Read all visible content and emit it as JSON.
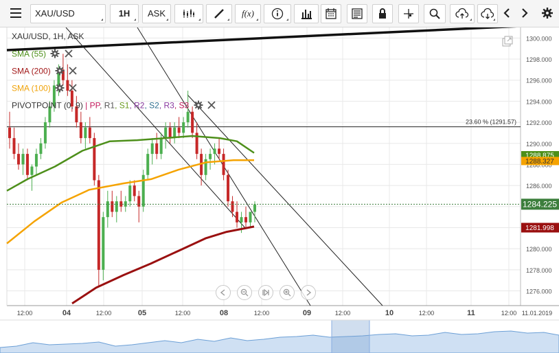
{
  "toolbar": {
    "menu_icon": "hamburger-icon",
    "symbol": "XAU/USD",
    "timeframe": "1H",
    "price_side": "ASK",
    "icons": [
      "candle-type-icon",
      "draw-line-icon",
      "function-icon",
      "info-icon",
      "bar-chart-icon",
      "calendar-icon",
      "news-icon",
      "lock-icon",
      "crosshair-icon",
      "zoom-icon",
      "upload-icon",
      "download-icon",
      "prev-icon",
      "next-icon",
      "settings-icon"
    ],
    "fx_label": "f(x)"
  },
  "chart_title": "XAU/USD, 1H, ASK",
  "indicators": {
    "sma55": {
      "label": "SMA (55)",
      "color": "#4d8f1a"
    },
    "sma200": {
      "label": "SMA (200)",
      "color": "#a31a1a"
    },
    "sma100": {
      "label": "SMA (100)",
      "color": "#f0a30a"
    },
    "pivot": {
      "label": "PIVOTPOINT",
      "params": "(0, 9)",
      "levels": [
        "PP",
        "R1",
        "S1",
        "R2",
        "S2",
        "R3",
        "S3"
      ],
      "level_colors": [
        "#c2185b",
        "#555555",
        "#6a9a20",
        "#8a3aa0",
        "#2f6f8f",
        "#8a3aa0",
        "#c2185b"
      ]
    }
  },
  "fib_label": "23.60 % (1291.57)",
  "colors": {
    "up": "#4caf50",
    "down": "#c62828",
    "sma55": "#4d8f1a",
    "sma100": "#f5a300",
    "sma200": "#9a1010",
    "grid": "#e8e8e8",
    "price_tag": "#3c7e3c"
  },
  "price_badges": {
    "sma55": "1288.875",
    "sma100": "1288.327",
    "last": "1284.225",
    "sma200": "1281.998"
  },
  "chart_data": {
    "type": "candlestick",
    "y_ticks": [
      "1300.000",
      "1298.000",
      "1296.000",
      "1294.000",
      "1292.000",
      "1290.000",
      "1288.000",
      "1286.000",
      "1284.000",
      "1282.000",
      "1280.000",
      "1278.000",
      "1276.000"
    ],
    "ylim": [
      1274.6,
      1301.0
    ],
    "x_ticks": [
      "12:00",
      "04",
      "12:00",
      "05",
      "12:00",
      "08",
      "12:00",
      "09",
      "12:00",
      "10",
      "12:00",
      "11",
      "12:00",
      "11.01.2019"
    ],
    "candles": [
      [
        1291.5,
        1293.0,
        1289.5,
        1290.5
      ],
      [
        1290.5,
        1291.5,
        1288.5,
        1289.0
      ],
      [
        1289.0,
        1290.0,
        1287.5,
        1288.0
      ],
      [
        1288.0,
        1289.5,
        1287.0,
        1289.0
      ],
      [
        1289.0,
        1289.5,
        1286.5,
        1287.0
      ],
      [
        1287.0,
        1288.0,
        1285.5,
        1287.8
      ],
      [
        1287.8,
        1289.5,
        1287.0,
        1289.0
      ],
      [
        1289.0,
        1290.5,
        1288.5,
        1290.0
      ],
      [
        1290.0,
        1292.5,
        1289.5,
        1292.0
      ],
      [
        1292.0,
        1294.0,
        1291.5,
        1293.5
      ],
      [
        1293.5,
        1296.0,
        1293.0,
        1295.5
      ],
      [
        1295.5,
        1297.5,
        1294.5,
        1297.0
      ],
      [
        1297.0,
        1298.5,
        1295.5,
        1296.0
      ],
      [
        1296.0,
        1297.5,
        1294.5,
        1295.0
      ],
      [
        1295.0,
        1296.0,
        1293.0,
        1293.5
      ],
      [
        1293.5,
        1294.5,
        1291.5,
        1292.0
      ],
      [
        1292.0,
        1293.0,
        1290.0,
        1290.5
      ],
      [
        1290.5,
        1292.0,
        1289.5,
        1291.5
      ],
      [
        1291.5,
        1292.5,
        1290.0,
        1290.5
      ],
      [
        1290.5,
        1291.0,
        1286.0,
        1286.5
      ],
      [
        1286.5,
        1287.0,
        1276.5,
        1278.0
      ],
      [
        1278.0,
        1283.5,
        1277.0,
        1283.0
      ],
      [
        1283.0,
        1285.5,
        1282.0,
        1284.5
      ],
      [
        1284.5,
        1285.5,
        1283.0,
        1283.5
      ],
      [
        1283.5,
        1285.0,
        1282.5,
        1284.5
      ],
      [
        1284.5,
        1285.5,
        1283.5,
        1284.0
      ],
      [
        1284.0,
        1285.0,
        1283.5,
        1284.5
      ],
      [
        1284.5,
        1286.5,
        1284.0,
        1286.0
      ],
      [
        1286.0,
        1286.5,
        1284.5,
        1285.0
      ],
      [
        1285.0,
        1285.5,
        1282.5,
        1284.0
      ],
      [
        1284.0,
        1287.5,
        1283.5,
        1287.0
      ],
      [
        1287.0,
        1289.5,
        1286.5,
        1289.0
      ],
      [
        1289.0,
        1290.5,
        1288.0,
        1290.0
      ],
      [
        1290.0,
        1291.0,
        1288.5,
        1289.0
      ],
      [
        1289.0,
        1291.0,
        1288.5,
        1290.5
      ],
      [
        1290.5,
        1292.0,
        1289.5,
        1291.5
      ],
      [
        1291.5,
        1292.0,
        1290.0,
        1290.5
      ],
      [
        1290.5,
        1292.0,
        1290.0,
        1291.5
      ],
      [
        1291.5,
        1292.5,
        1290.5,
        1291.0
      ],
      [
        1291.0,
        1292.5,
        1290.5,
        1292.0
      ],
      [
        1292.0,
        1295.0,
        1291.5,
        1293.0
      ],
      [
        1293.0,
        1293.5,
        1290.5,
        1291.0
      ],
      [
        1291.0,
        1292.0,
        1288.5,
        1289.0
      ],
      [
        1289.0,
        1289.5,
        1286.0,
        1287.0
      ],
      [
        1287.0,
        1289.0,
        1286.5,
        1288.5
      ],
      [
        1288.5,
        1289.5,
        1287.5,
        1289.0
      ],
      [
        1289.0,
        1290.0,
        1288.0,
        1289.5
      ],
      [
        1289.5,
        1290.5,
        1288.5,
        1289.0
      ],
      [
        1289.0,
        1289.5,
        1286.5,
        1287.0
      ],
      [
        1287.0,
        1287.5,
        1284.0,
        1284.5
      ],
      [
        1284.5,
        1285.0,
        1283.0,
        1283.5
      ],
      [
        1283.5,
        1284.5,
        1282.0,
        1282.5
      ],
      [
        1282.5,
        1283.5,
        1281.5,
        1283.0
      ],
      [
        1283.0,
        1284.0,
        1282.0,
        1282.5
      ],
      [
        1282.5,
        1283.5,
        1282.0,
        1283.5
      ],
      [
        1283.5,
        1284.5,
        1282.5,
        1284.2
      ]
    ],
    "sma55": [
      1289.0,
      1289.8,
      1290.2,
      1290.4,
      1290.5,
      1290.4,
      1290.2,
      1290.0,
      1289.7,
      1289.5,
      1289.3,
      1289.0,
      1288.8
    ],
    "sma100": [
      1284.6,
      1285.5,
      1286.2,
      1286.8,
      1287.3,
      1287.7,
      1288.0,
      1288.2,
      1288.3,
      1288.4,
      1288.5,
      1288.3
    ],
    "sma200": [
      1274.7,
      1276.0,
      1277.0,
      1277.8,
      1278.6,
      1279.3,
      1280.0,
      1280.6,
      1281.2,
      1281.7,
      1282.0
    ],
    "horizontal_line": 1291.57
  },
  "nav_controls": [
    "scroll-left-icon",
    "zoom-out-icon",
    "reset-icon",
    "zoom-in-icon",
    "scroll-right-icon"
  ]
}
